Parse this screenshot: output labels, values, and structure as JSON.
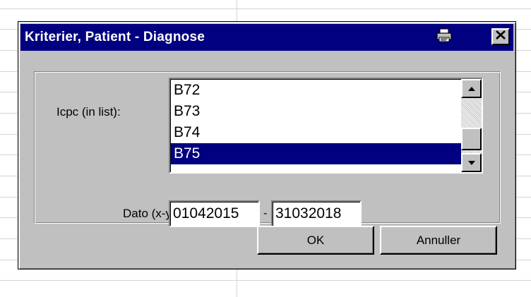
{
  "window": {
    "title": "Kriterier, Patient - Diagnose",
    "print_icon": "printer-icon",
    "close_label": "✕"
  },
  "form": {
    "icpc_label": "Icpc (in list):",
    "icpc_items": [
      {
        "label": "B72",
        "selected": false
      },
      {
        "label": "B73",
        "selected": false
      },
      {
        "label": "B74",
        "selected": false
      },
      {
        "label": "B75",
        "selected": true
      }
    ],
    "dato_label": "Dato (x-y):",
    "date_from": "01042015",
    "date_separator": "-",
    "date_to": "31032018"
  },
  "buttons": {
    "ok_label": "OK",
    "cancel_label": "Annuller"
  },
  "colors": {
    "titlebar": "#000080",
    "selection": "#000080",
    "face": "#c0c0c0"
  }
}
